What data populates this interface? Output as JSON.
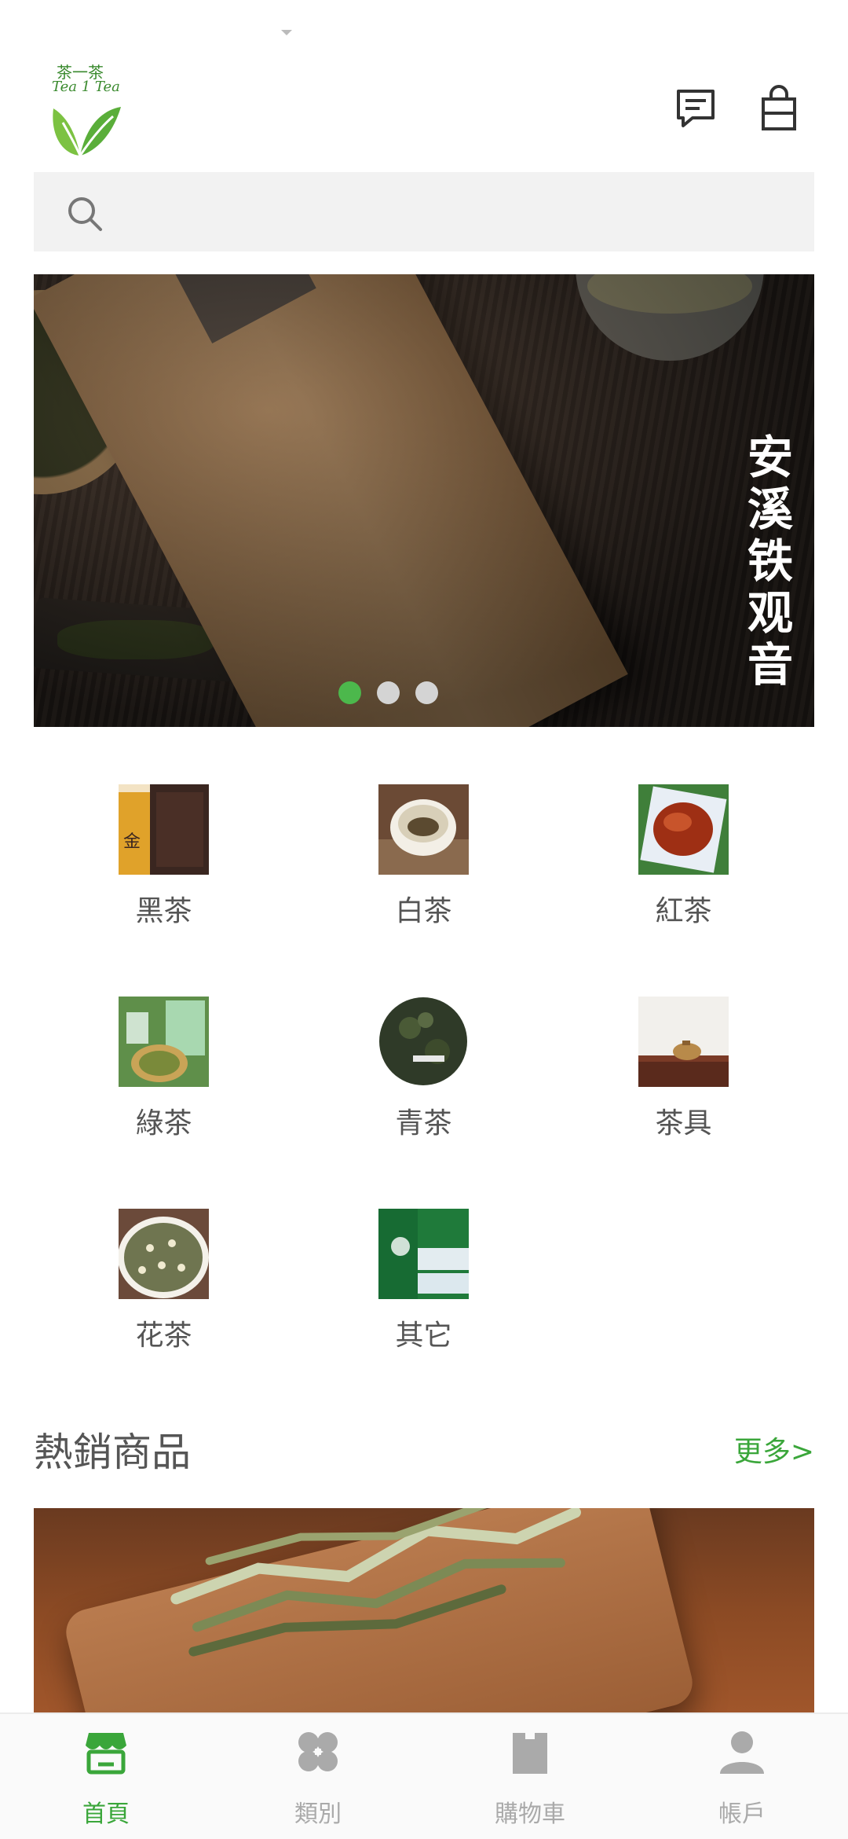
{
  "header": {
    "logo_cn": "茶一茶",
    "logo_en": "Tea 1 Tea"
  },
  "search": {
    "placeholder": "",
    "value": ""
  },
  "banner": {
    "text": "安溪铁观音",
    "text_chars": [
      "安",
      "溪",
      "铁",
      "观",
      "音"
    ],
    "slide_count": 3,
    "active_slide": 1
  },
  "categories": [
    {
      "label": "黑茶"
    },
    {
      "label": "白茶"
    },
    {
      "label": "紅茶"
    },
    {
      "label": "綠茶"
    },
    {
      "label": "青茶"
    },
    {
      "label": "茶具"
    },
    {
      "label": "花茶"
    },
    {
      "label": "其它"
    }
  ],
  "hot": {
    "title": "熱銷商品",
    "more": "更多>"
  },
  "nav": {
    "items": [
      {
        "label": "首頁",
        "icon": "store-icon",
        "active": true
      },
      {
        "label": "類別",
        "icon": "category-icon",
        "active": false
      },
      {
        "label": "購物車",
        "icon": "cart-bag-icon",
        "active": false
      },
      {
        "label": "帳戶",
        "icon": "account-icon",
        "active": false
      }
    ]
  },
  "colors": {
    "accent": "#3aa63a",
    "dot_active": "#4cb84c",
    "dot_inactive": "#d4d4d4",
    "nav_inactive": "#aaaaaa"
  }
}
